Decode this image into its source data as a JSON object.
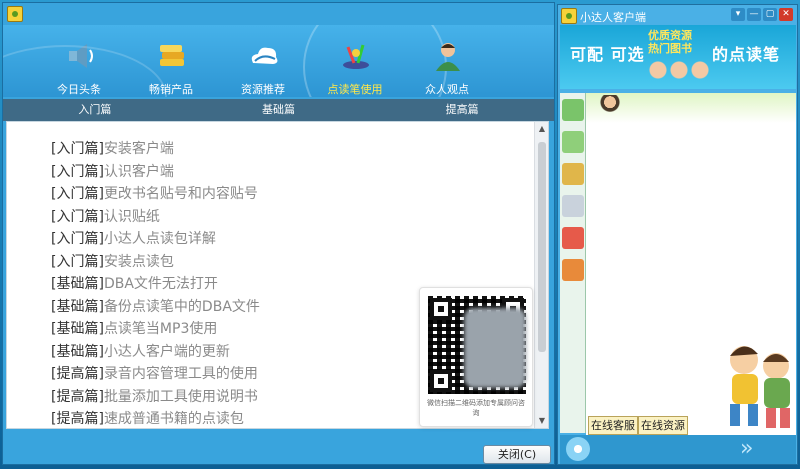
{
  "main": {
    "nav": [
      {
        "label": "今日头条",
        "icon": "speaker-icon"
      },
      {
        "label": "畅销产品",
        "icon": "books-icon"
      },
      {
        "label": "资源推荐",
        "icon": "cloud-icon"
      },
      {
        "label": "点读笔使用",
        "icon": "pen-icon",
        "active": true
      },
      {
        "label": "众人观点",
        "icon": "person-icon"
      }
    ],
    "subnav": [
      "入门篇",
      "基础篇",
      "提高篇"
    ],
    "articles": [
      {
        "tag": "[入门篇]",
        "title": "安装客户端"
      },
      {
        "tag": "[入门篇]",
        "title": "认识客户端"
      },
      {
        "tag": "[入门篇]",
        "title": "更改书名贴号和内容贴号"
      },
      {
        "tag": "[入门篇]",
        "title": "认识贴纸"
      },
      {
        "tag": "[入门篇]",
        "title": "小达人点读包详解"
      },
      {
        "tag": "[入门篇]",
        "title": "安装点读包"
      },
      {
        "tag": "[基础篇]",
        "title": "DBA文件无法打开"
      },
      {
        "tag": "[基础篇]",
        "title": "备份点读笔中的DBA文件"
      },
      {
        "tag": "[基础篇]",
        "title": "点读笔当MP3使用"
      },
      {
        "tag": "[基础篇]",
        "title": "小达人客户端的更新"
      },
      {
        "tag": "[提高篇]",
        "title": "录音内容管理工具的使用"
      },
      {
        "tag": "[提高篇]",
        "title": "批量添加工具使用说明书"
      },
      {
        "tag": "[提高篇]",
        "title": "速成普通书籍的点读包"
      }
    ],
    "qr_caption": "微信扫描二维码添加专属顾问咨询",
    "close_label": "关闭(C)"
  },
  "side": {
    "title": "小达人客户端",
    "banner_text": "可配 可选",
    "banner_highlight": "优质资源 热门图书",
    "banner_tail": "的点读笔",
    "btn_service": "在线客服",
    "btn_resources": "在线资源",
    "controls": [
      "▾",
      "—",
      "▢",
      "✕"
    ]
  },
  "colors": {
    "accent": "#3aa3dd",
    "nav_active": "#ffe84a",
    "subnav_bg": "#3f6a86"
  }
}
